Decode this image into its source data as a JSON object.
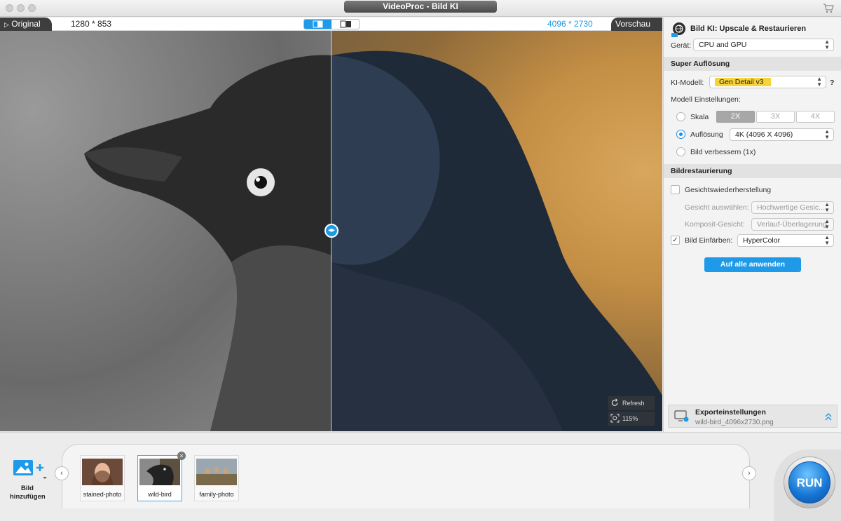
{
  "window": {
    "title": "VideoProc - Bild KI"
  },
  "preview": {
    "original_label": "Original",
    "original_resolution": "1280 * 853",
    "output_resolution": "4096 * 2730",
    "preview_label": "Vorschau",
    "refresh_label": "Refresh",
    "zoom_label": "115%"
  },
  "panel": {
    "title": "Bild KI:  Upscale & Restaurieren",
    "device_label": "Gerät:",
    "device_value": "CPU and GPU",
    "super_resolution": {
      "header": "Super Auflösung",
      "model_label": "KI-Modell:",
      "model_value": "Gen Detail v3",
      "help": "?",
      "settings_label": "Modell Einstellungen:",
      "scale_label": "Skala",
      "scale_options": [
        "2X",
        "3X",
        "4X"
      ],
      "scale_selected": "2X",
      "resolution_label": "Auflösung",
      "resolution_value": "4K (4096 X 4096)",
      "enhance_label": "Bild verbessern (1x)",
      "selected_mode": "Auflösung"
    },
    "restoration": {
      "header": "Bildrestaurierung",
      "face_restore_label": "Gesichtswiederherstellung",
      "face_restore_checked": false,
      "face_select_label": "Gesicht auswählen:",
      "face_select_value": "Hochwertige Gesic...",
      "composite_label": "Komposit-Gesicht:",
      "composite_value": "Verlauf-Überlagerung",
      "colorize_label": "Bild Einfärben:",
      "colorize_checked": true,
      "colorize_value": "HyperColor"
    },
    "apply_all_label": "Auf alle anwenden",
    "export": {
      "title": "Exporteinstellungen",
      "filename": "wild-bird_4096x2730.png"
    }
  },
  "bottom": {
    "add_image_label_line1": "Bild",
    "add_image_label_line2": "hinzufügen",
    "thumbnails": [
      {
        "caption": "stained-photo",
        "selected": false
      },
      {
        "caption": "wild-bird",
        "selected": true
      },
      {
        "caption": "family-photo",
        "selected": false
      }
    ],
    "run_label": "RUN"
  },
  "colors": {
    "accent": "#1e9ae8",
    "highlight": "#f7d33a",
    "dark_tag": "#3e3e3e"
  }
}
